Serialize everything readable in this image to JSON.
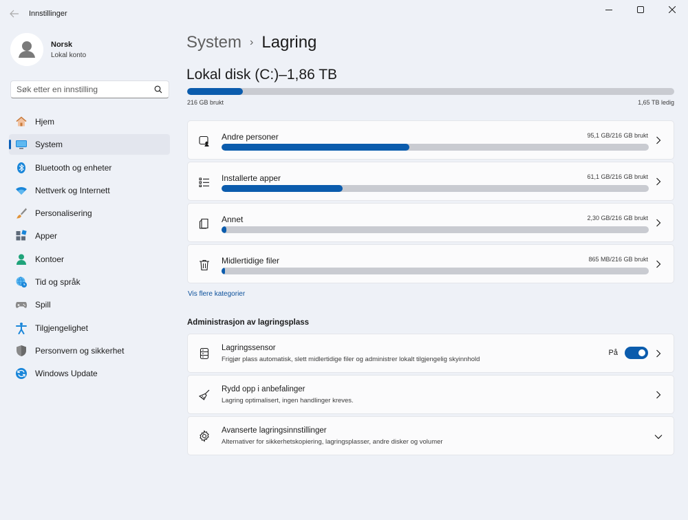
{
  "window": {
    "title": "Innstillinger"
  },
  "profile": {
    "name": "Norsk",
    "account_type": "Lokal konto"
  },
  "search": {
    "placeholder": "Søk etter en innstilling"
  },
  "sidebar": {
    "items": [
      {
        "label": "Hjem",
        "icon": "home-icon"
      },
      {
        "label": "System",
        "icon": "system-icon",
        "active": true
      },
      {
        "label": "Bluetooth og enheter",
        "icon": "bluetooth-icon"
      },
      {
        "label": "Nettverk og Internett",
        "icon": "wifi-icon"
      },
      {
        "label": "Personalisering",
        "icon": "brush-icon"
      },
      {
        "label": "Apper",
        "icon": "apps-icon"
      },
      {
        "label": "Kontoer",
        "icon": "account-icon"
      },
      {
        "label": "Tid og språk",
        "icon": "globe-clock-icon"
      },
      {
        "label": "Spill",
        "icon": "gamepad-icon"
      },
      {
        "label": "Tilgjengelighet",
        "icon": "accessibility-icon"
      },
      {
        "label": "Personvern og sikkerhet",
        "icon": "shield-icon"
      },
      {
        "label": "Windows Update",
        "icon": "update-icon"
      }
    ]
  },
  "breadcrumb": {
    "parent": "System",
    "separator": "›",
    "current": "Lagring"
  },
  "disk": {
    "title": "Lokal disk (C:)–1,86 TB",
    "used_label": "216 GB brukt",
    "free_label": "1,65 TB ledig",
    "used_fraction": 0.115
  },
  "categories": [
    {
      "name": "Andre personer",
      "size": "95,1 GB/216 GB brukt",
      "fraction": 0.44,
      "icon": "other-users-icon"
    },
    {
      "name": "Installerte apper",
      "size": "61,1 GB/216 GB brukt",
      "fraction": 0.283,
      "icon": "installed-apps-icon"
    },
    {
      "name": "Annet",
      "size": "2,30 GB/216 GB brukt",
      "fraction": 0.011,
      "icon": "other-files-icon"
    },
    {
      "name": "Midlertidige filer",
      "size": "865 MB/216 GB brukt",
      "fraction": 0.004,
      "icon": "trash-icon"
    }
  ],
  "more_categories_link": "Vis flere kategorier",
  "admin": {
    "section_title": "Administrasjon av lagringsplass",
    "storage_sense": {
      "title": "Lagringssensor",
      "description": "Frigjør plass automatisk, slett midlertidige filer og administrer lokalt tilgjengelig skyinnhold",
      "toggle_label": "På",
      "enabled": true
    },
    "cleanup": {
      "title": "Rydd opp i anbefalinger",
      "description": "Lagring optimalisert, ingen handlinger kreves."
    },
    "advanced": {
      "title": "Avanserte lagringsinnstillinger",
      "description": "Alternativer for sikkerhetskopiering, lagringsplasser, andre disker og volumer"
    }
  },
  "colors": {
    "accent": "#0b5cad",
    "track": "#c9cbd1",
    "background": "#eef1f7"
  }
}
